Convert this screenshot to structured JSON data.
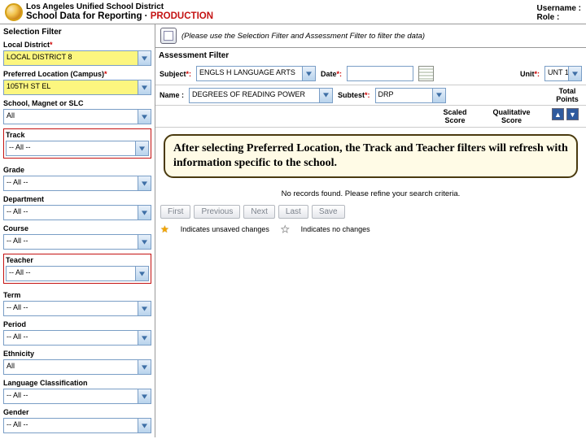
{
  "header": {
    "org": "Los Angeles Unified School District",
    "app": "School Data for Reporting · ",
    "env": "PRODUCTION",
    "username_label": "Username :",
    "role_label": "Role :"
  },
  "sidebar": {
    "section": "Selection Filter",
    "fields": [
      {
        "label": "Local District",
        "req": "*",
        "value": "LOCAL DISTRICT 8",
        "highlight": true,
        "redbox": false
      },
      {
        "label": "Preferred Location (Campus)",
        "req": "*",
        "value": "105TH ST EL",
        "highlight": true,
        "redbox": false
      },
      {
        "label": "School, Magnet or SLC",
        "req": "",
        "value": "All",
        "highlight": false,
        "redbox": false
      },
      {
        "label": "Track",
        "req": "",
        "value": "-- All --",
        "highlight": false,
        "redbox": true
      },
      {
        "label": "Grade",
        "req": "",
        "value": "-- All --",
        "highlight": false,
        "redbox": false
      },
      {
        "label": "Department",
        "req": "",
        "value": "-- All --",
        "highlight": false,
        "redbox": false
      },
      {
        "label": "Course",
        "req": "",
        "value": "-- All --",
        "highlight": false,
        "redbox": false
      },
      {
        "label": "Teacher",
        "req": "",
        "value": "-- All --",
        "highlight": false,
        "redbox": true
      },
      {
        "label": "Term",
        "req": "",
        "value": "-- All --",
        "highlight": false,
        "redbox": false
      },
      {
        "label": "Period",
        "req": "",
        "value": "-- All --",
        "highlight": false,
        "redbox": false
      },
      {
        "label": "Ethnicity",
        "req": "",
        "value": "All",
        "highlight": false,
        "redbox": false
      },
      {
        "label": "Language Classification",
        "req": "",
        "value": "-- All --",
        "highlight": false,
        "redbox": false
      },
      {
        "label": "Gender",
        "req": "",
        "value": "-- All --",
        "highlight": false,
        "redbox": false
      }
    ]
  },
  "content": {
    "hint": "(Please use the Selection Filter and Assessment Filter to filter the data)",
    "af_title": "Assessment Filter",
    "row1": {
      "subject_label": "Subject",
      "subject_req": "*:",
      "subject_val": "ENGLS H LANGUAGE ARTS",
      "date_label": "Date",
      "date_req": "*:",
      "unit_label": "Unit",
      "unit_req": "*:",
      "unit_val": "UNT 1"
    },
    "row2": {
      "name_label": "Name :",
      "name_val": "DEGREES OF READING POWER",
      "subtest_label": "Subtest",
      "subtest_req": "*:",
      "subtest_val": "DRP",
      "tp_label": "Total Points"
    },
    "score_headers": {
      "scaled": "Scaled Score",
      "qual": "Qualitative Score"
    },
    "callout": "After selecting Preferred Location, the Track and Teacher filters will refresh with information specific to the school.",
    "norecords": "No records found. Please refine your search criteria.",
    "pager": {
      "first": "First",
      "prev": "Previous",
      "next": "Next",
      "last": "Last",
      "save": "Save"
    },
    "legend": {
      "unsaved": "Indicates unsaved changes",
      "nochg": "Indicates no changes"
    }
  }
}
